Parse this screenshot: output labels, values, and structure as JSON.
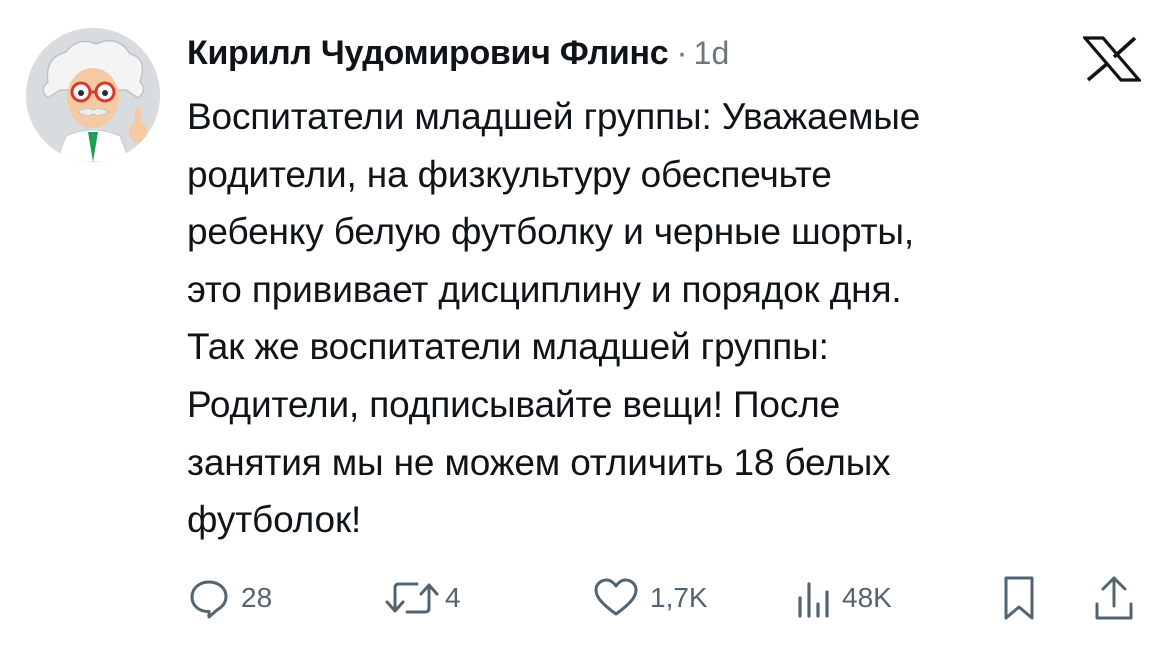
{
  "author": {
    "name": "Кирилл Чудомирович Флинс",
    "separator": "·",
    "time": "1d"
  },
  "platform": {
    "logo_icon": "x-logo-icon"
  },
  "tweet": {
    "lines": [
      "Воспитатели младшей группы: Уважаемые",
      "родители, на физкультуру обеспечьте",
      "ребенку белую футболку и черные шорты,",
      "это прививает дисциплину и порядок дня.",
      "Так же воспитатели младшей группы:",
      "Родители, подписывайте вещи! После",
      "занятия мы не можем отличить 18 белых",
      "футболок!"
    ]
  },
  "actions": {
    "replies": {
      "icon": "reply-icon",
      "count": "28"
    },
    "retweets": {
      "icon": "retweet-icon",
      "count": "4"
    },
    "likes": {
      "icon": "heart-icon",
      "count": "1,7K"
    },
    "views": {
      "icon": "views-icon",
      "count": "48K"
    },
    "bookmark": {
      "icon": "bookmark-icon"
    },
    "share": {
      "icon": "share-icon"
    }
  },
  "colors": {
    "text": "#0f1419",
    "muted": "#536471",
    "background": "#ffffff"
  }
}
